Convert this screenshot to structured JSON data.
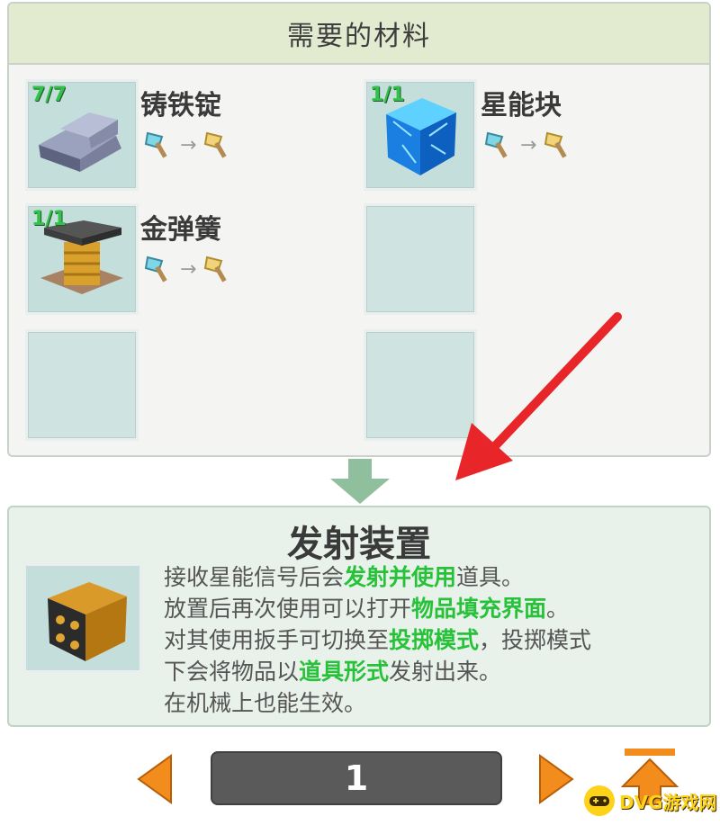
{
  "materials": {
    "header": "需要的材料",
    "items": [
      {
        "name": "铸铁锭",
        "count": "7/7"
      },
      {
        "name": "星能块",
        "count": "1/1"
      },
      {
        "name": "金弹簧",
        "count": "1/1"
      }
    ]
  },
  "product": {
    "title": "发射装置",
    "lines": [
      [
        {
          "t": "接收星能信号后会"
        },
        {
          "t": "发射并使用",
          "h": 1
        },
        {
          "t": "道具。"
        }
      ],
      [
        {
          "t": "放置后再次使用可以打开"
        },
        {
          "t": "物品填充界面",
          "h": 1
        },
        {
          "t": "。"
        }
      ],
      [
        {
          "t": "对其使用扳手可切换至"
        },
        {
          "t": "投掷模式",
          "h": 1
        },
        {
          "t": "，投掷模式"
        }
      ],
      [
        {
          "t": "下会将物品以"
        },
        {
          "t": "道具形式",
          "h": 1
        },
        {
          "t": "发射出来。"
        }
      ],
      [
        {
          "t": "在机械上也能生效。"
        }
      ]
    ]
  },
  "pagination": {
    "page": "1"
  },
  "watermark": {
    "text": "DVG游戏网"
  },
  "colors": {
    "highlight": "#28c23a",
    "count": "#33c14c",
    "pointer_arrow": "#e8262a"
  },
  "icons": {
    "tool_from": "axe-tier-blue-icon",
    "tool_to": "axe-tier-gold-icon",
    "prev": "triangle-left-icon",
    "next": "triangle-right-icon",
    "top": "arrow-to-top-icon"
  }
}
